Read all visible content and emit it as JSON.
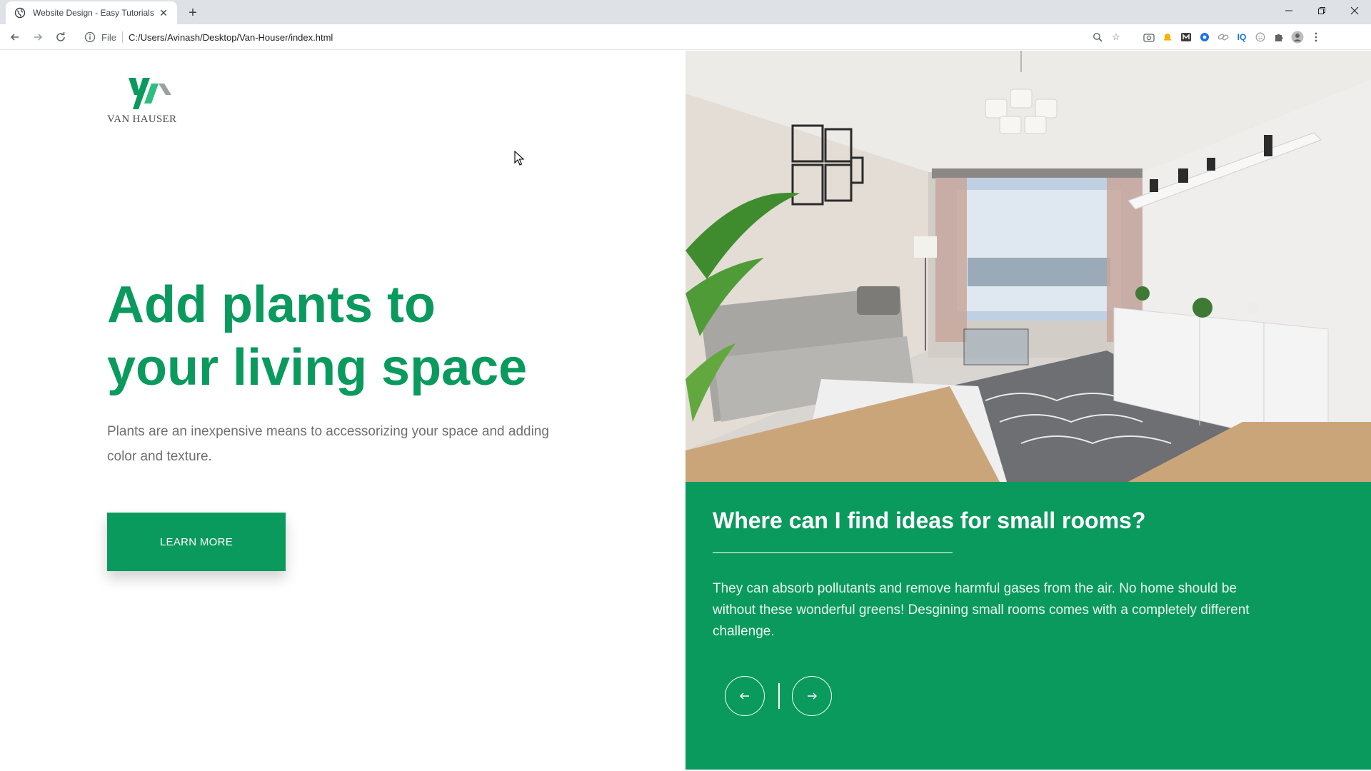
{
  "browser": {
    "tab_title": "Website Design - Easy Tutorials",
    "address_prefix": "File",
    "url": "C:/Users/Avinash/Desktop/Van-Houser/index.html"
  },
  "site": {
    "logo_text": "VAN HAUSER",
    "hero": {
      "title_line1": "Add plants to",
      "title_line2": "your living space",
      "description": "Plants are an inexpensive means to accessorizing your space and adding color and texture.",
      "button_label": "LEARN MORE"
    },
    "card": {
      "title": "Where can I find ideas for small rooms?",
      "body": "They can absorb pollutants and remove harmful gases from the air. No home should be without these wonderful greens! Desgining small rooms comes with a completely different challenge."
    }
  },
  "colors": {
    "brand_green": "#0a9a5d",
    "text_gray": "#707070"
  }
}
